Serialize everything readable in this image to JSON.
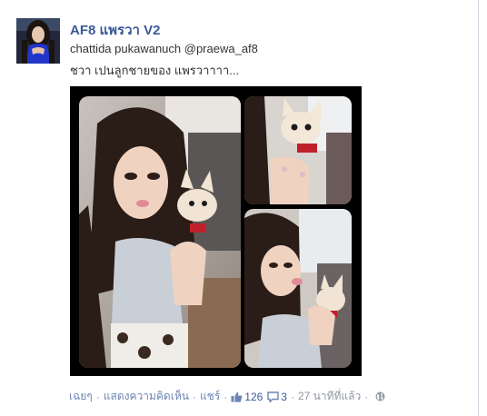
{
  "post": {
    "author": "AF8 แพรวา V2",
    "message_line1": "chattida pukawanuch @praewa_af8",
    "message_line2": "ชวา เปนลูกชายของ แพรวาาาา...",
    "photo_alt": "collage of a girl holding a chihuahua"
  },
  "actions": {
    "like": "เฉยๆ",
    "comment": "แสดงความคิดเห็น",
    "share": "แชร์",
    "like_count": "126",
    "comment_count": "3",
    "timestamp": "27 นาทีที่แล้ว",
    "separator": "·"
  },
  "colors": {
    "link": "#3b5998",
    "action_link": "#6d84b4",
    "muted": "#9197a3",
    "photo_border": "#000000"
  },
  "icons": {
    "like": "thumbs-up-icon",
    "comment": "speech-bubble-icon",
    "privacy": "globe-icon"
  }
}
